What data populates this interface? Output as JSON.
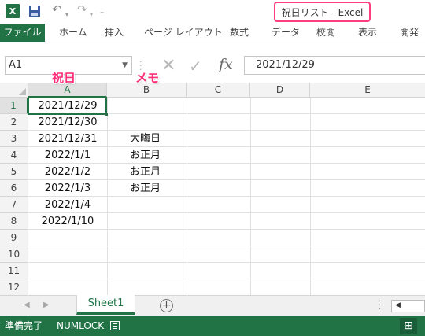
{
  "titlebar": {
    "app_logo": "X",
    "window_title": "祝日リスト - Excel",
    "icons": [
      "excel-icon",
      "save-icon",
      "undo-icon",
      "redo-icon",
      "customize-icon"
    ]
  },
  "ribbon": {
    "tabs": [
      "ファイル",
      "ホーム",
      "挿入",
      "ページ レイアウト",
      "数式",
      "データ",
      "校閲",
      "表示",
      "開発"
    ]
  },
  "formula_bar": {
    "name_box": "A1",
    "formula_value": "2021/12/29",
    "fx_label": "fx"
  },
  "annotations": {
    "col_a_note": "祝日",
    "col_b_note": "メモ",
    "accent": "#ff2d78"
  },
  "sheet": {
    "columns": [
      "A",
      "B",
      "C",
      "D",
      "E"
    ],
    "rows": [
      "1",
      "2",
      "3",
      "4",
      "5",
      "6",
      "7",
      "8",
      "9",
      "10",
      "11",
      "12"
    ],
    "cells": [
      {
        "a": "2021/12/29",
        "b": ""
      },
      {
        "a": "2021/12/30",
        "b": ""
      },
      {
        "a": "2021/12/31",
        "b": "大晦日"
      },
      {
        "a": "2022/1/1",
        "b": "お正月"
      },
      {
        "a": "2022/1/2",
        "b": "お正月"
      },
      {
        "a": "2022/1/3",
        "b": "お正月"
      },
      {
        "a": "2022/1/4",
        "b": ""
      },
      {
        "a": "2022/1/10",
        "b": ""
      },
      {
        "a": "",
        "b": ""
      },
      {
        "a": "",
        "b": ""
      },
      {
        "a": "",
        "b": ""
      },
      {
        "a": "",
        "b": ""
      }
    ],
    "selected_cell": "A1"
  },
  "sheet_tabs": {
    "active": "Sheet1",
    "add_label": "+"
  },
  "statusbar": {
    "ready": "準備完了",
    "numlock": "NUMLOCK"
  },
  "colors": {
    "excel_green": "#217346",
    "highlight_border": "#ff3d7f"
  }
}
